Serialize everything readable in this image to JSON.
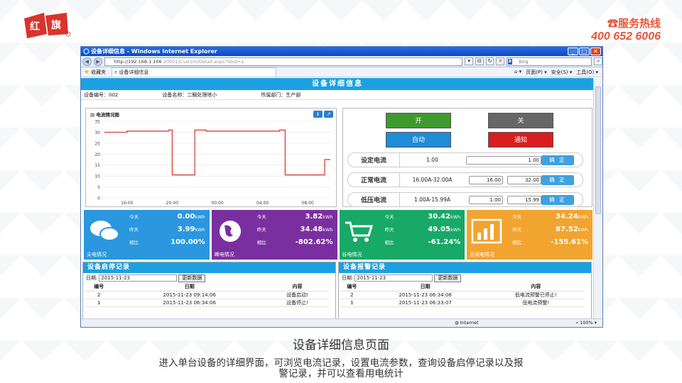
{
  "brand": {
    "hotline_title": "服务热线",
    "hotline_number": "400 652 6006"
  },
  "browser": {
    "window_title": "设备详细信息 - Windows Internet Explorer",
    "url_host": "http://192.168.1.106",
    "url_path": ":20001/Custom/Detail.aspx?Sbid=2",
    "search_placeholder": "Bing",
    "search_logo": "B",
    "favorites_label": "收藏夹",
    "tab_label": "设备详细信息",
    "tools": [
      "页面(P) ▾",
      "安全(S) ▾",
      "工具(O) ▾"
    ],
    "status_zone": "Internet",
    "zoom": "100%"
  },
  "page": {
    "title": "设备详细信息",
    "device_no": "设备编号：002",
    "device_name": "设备名称：二鲷处理塔小",
    "department": "所属部门：生产部"
  },
  "chart": {
    "title": "电流情况图",
    "icons": [
      "ℹ",
      "↗"
    ],
    "y_ticks": [
      0,
      5,
      10,
      15,
      20,
      25,
      30,
      35
    ],
    "x_ticks": [
      "16:00",
      "20:00",
      "00:00",
      "04:00",
      "08:00"
    ]
  },
  "chart_data": {
    "type": "line",
    "title": "电流情况图",
    "x": [
      "14:00",
      "16:00",
      "18:00",
      "19:40",
      "20:00",
      "22:00",
      "23:00",
      "00:00",
      "02:00",
      "04:00",
      "05:30",
      "06:00",
      "08:00",
      "09:00",
      "09:30",
      "10:00"
    ],
    "y": [
      30,
      30.5,
      30.5,
      31,
      10.5,
      31,
      30.5,
      30.5,
      30.5,
      30.5,
      31,
      10.5,
      10.5,
      10.5,
      17.5,
      17.5
    ],
    "ylim": [
      0,
      35
    ],
    "xlabel": "",
    "ylabel": "",
    "series": [
      {
        "values": [
          30,
          30.5,
          30.5,
          31,
          10.5,
          31,
          30.5,
          30.5,
          30.5,
          30.5,
          31,
          10.5,
          10.5,
          10.5,
          17.5,
          17.5
        ]
      }
    ]
  },
  "controls": {
    "on": "开",
    "off": "关",
    "auto": "自动",
    "notify": "通知",
    "rows": [
      {
        "label": "设定电流",
        "range": "1.00",
        "value": "1.00",
        "min": "",
        "ok": "确 定"
      },
      {
        "label": "正常电流",
        "range": "16.00A-32.00A",
        "min": "16.00",
        "value": "32.00",
        "ok": "确 定"
      },
      {
        "label": "低压电流",
        "range": "1.00A-15.99A",
        "min": "1.00",
        "value": "15.99",
        "ok": "确 定"
      }
    ]
  },
  "tiles": [
    {
      "name": "尖电情况",
      "color": "#2a97de",
      "rows": [
        {
          "k": "今天",
          "v": "0.00",
          "u": "kWh"
        },
        {
          "k": "昨天",
          "v": "3.99",
          "u": "kWh"
        },
        {
          "k": "相比",
          "v": "100.00%",
          "u": ""
        }
      ]
    },
    {
      "name": "峰电情况",
      "color": "#7a2fa0",
      "rows": [
        {
          "k": "今天",
          "v": "3.82",
          "u": "kWh"
        },
        {
          "k": "昨天",
          "v": "34.48",
          "u": "kWh"
        },
        {
          "k": "相比",
          "v": "-802.62%",
          "u": ""
        }
      ]
    },
    {
      "name": "谷电情况",
      "color": "#18a868",
      "rows": [
        {
          "k": "今天",
          "v": "30.42",
          "u": "kWh"
        },
        {
          "k": "昨天",
          "v": "49.05",
          "u": "kWh"
        },
        {
          "k": "相比",
          "v": "-61.24%",
          "u": ""
        }
      ]
    },
    {
      "name": "总用电情况",
      "color": "#f2a430",
      "rows": [
        {
          "k": "今天",
          "v": "34.24",
          "u": "kWh"
        },
        {
          "k": "昨天",
          "v": "87.52",
          "u": "kWh"
        },
        {
          "k": "相比",
          "v": "-155.61%",
          "u": ""
        }
      ]
    }
  ],
  "start_log": {
    "title": "设备启停记录",
    "date_label": "日期:",
    "date": "2015-11-23",
    "update": "更新数据",
    "headers": [
      "编号",
      "日期",
      "内容"
    ],
    "rows": [
      [
        "2",
        "2015-11-23 09:14:06",
        "设备启动!"
      ],
      [
        "1",
        "2015-11-23 06:34:06",
        "设备停止!"
      ]
    ]
  },
  "alarm_log": {
    "title": "设备报警记录",
    "date_label": "日期:",
    "date": "2015-11-23",
    "update": "更新数据",
    "headers": [
      "编号",
      "日期",
      "内容"
    ],
    "rows": [
      [
        "2",
        "2015-11-23 06:34:06",
        "低电流预警已停止!"
      ],
      [
        "1",
        "2015-11-23 06:33:07",
        "低电流预警!"
      ]
    ]
  },
  "caption": {
    "title": "设备详细信息页面",
    "desc1": "进入单台设备的详细界面，可浏览电流记录，设置电流参数，查询设备启停记录以及报",
    "desc2": "警记录，并可以查看用电统计"
  }
}
